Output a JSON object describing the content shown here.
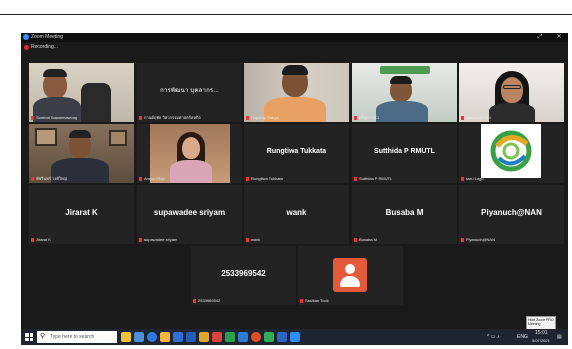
{
  "window": {
    "title": "Zoom Meeting",
    "recording_label": "Recording...",
    "minimize_glyph": "—",
    "maximize_glyph": "⤢",
    "close_glyph": "✕"
  },
  "tiles": [
    {
      "label": "Sombat Suwannawong",
      "name": ""
    },
    {
      "label": "กานต์ฤทัย วิศวกรรมศาสตร์สหกิจ",
      "name": "การพัฒนา บุคลากร..."
    },
    {
      "label": "Supornp Panya",
      "name": ""
    },
    {
      "label": "ศรีสุดา SCI",
      "name": ""
    },
    {
      "label": "Janyaporn Sri",
      "name": ""
    },
    {
      "label": "พัชรินทร์ วงศ์ใหญ่",
      "name": ""
    },
    {
      "label": "Ampa CMU",
      "name": ""
    },
    {
      "label": "Rungtiwa Tukkata",
      "name": "Rungtiwa Tukkata"
    },
    {
      "label": "Sutthida P RMUTL",
      "name": "Sutthida P RMUTL"
    },
    {
      "label": "ssru Logo",
      "name": ""
    },
    {
      "label": "Jirarat K",
      "name": "Jirarat K"
    },
    {
      "label": "supawadee sriyam",
      "name": "supawadee sriyam"
    },
    {
      "label": "wank",
      "name": "wank"
    },
    {
      "label": "Busaba M",
      "name": "Busaba M"
    },
    {
      "label": "Piyanuch@NAN",
      "name": "Piyanuch@NAN"
    },
    {
      "label": "2533969542",
      "name": "2533969542"
    },
    {
      "label": "Sasikan Tooli",
      "name": ""
    }
  ],
  "taskbar": {
    "search_placeholder": "Type here to search",
    "time": "15:01",
    "date": "5/07/2021",
    "lang": "ENG"
  },
  "tooltip": {
    "text": "Hide Zoom PRO Meeting"
  },
  "colors": {
    "active_speaker": "#c6e52a",
    "tile_bg": "#232323",
    "avatar_bg": "#e35b3a",
    "taskbar_bg": "#1e2430"
  }
}
